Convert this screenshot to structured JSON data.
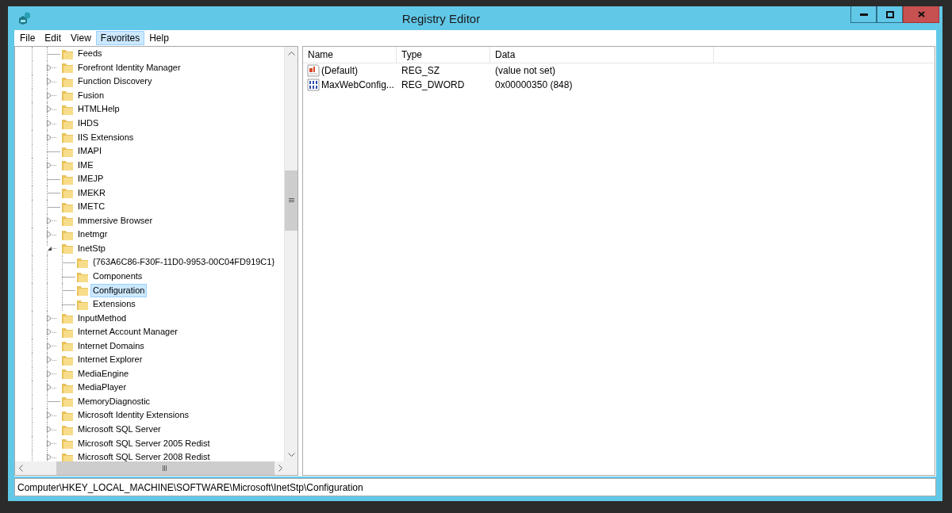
{
  "window": {
    "title": "Registry Editor"
  },
  "menu": [
    {
      "label": "File",
      "selected": false
    },
    {
      "label": "Edit",
      "selected": false
    },
    {
      "label": "View",
      "selected": false
    },
    {
      "label": "Favorites",
      "selected": true
    },
    {
      "label": "Help",
      "selected": false
    }
  ],
  "tree": {
    "items": [
      {
        "label": "Feeds",
        "kind": "leaf",
        "selected": false
      },
      {
        "label": "Forefront Identity Manager",
        "kind": "branch",
        "expanded": false,
        "selected": false
      },
      {
        "label": "Function Discovery",
        "kind": "branch",
        "expanded": false,
        "selected": false
      },
      {
        "label": "Fusion",
        "kind": "branch",
        "expanded": false,
        "selected": false
      },
      {
        "label": "HTMLHelp",
        "kind": "branch",
        "expanded": false,
        "selected": false
      },
      {
        "label": "IHDS",
        "kind": "branch",
        "expanded": false,
        "selected": false
      },
      {
        "label": "IIS Extensions",
        "kind": "branch",
        "expanded": false,
        "selected": false
      },
      {
        "label": "IMAPI",
        "kind": "leaf",
        "selected": false
      },
      {
        "label": "IME",
        "kind": "branch",
        "expanded": false,
        "selected": false
      },
      {
        "label": "IMEJP",
        "kind": "leaf",
        "selected": false
      },
      {
        "label": "IMEKR",
        "kind": "leaf",
        "selected": false
      },
      {
        "label": "IMETC",
        "kind": "leaf",
        "selected": false
      },
      {
        "label": "Immersive Browser",
        "kind": "branch",
        "expanded": false,
        "selected": false
      },
      {
        "label": "Inetmgr",
        "kind": "branch",
        "expanded": false,
        "selected": false
      },
      {
        "label": "InetStp",
        "kind": "branch",
        "expanded": true,
        "selected": false,
        "children": [
          {
            "label": "{763A6C86-F30F-11D0-9953-00C04FD919C1}",
            "kind": "leaf",
            "selected": false
          },
          {
            "label": "Components",
            "kind": "leaf",
            "selected": false
          },
          {
            "label": "Configuration",
            "kind": "leaf",
            "selected": true
          },
          {
            "label": "Extensions",
            "kind": "leaf",
            "selected": false
          }
        ]
      },
      {
        "label": "InputMethod",
        "kind": "branch",
        "expanded": false,
        "selected": false
      },
      {
        "label": "Internet Account Manager",
        "kind": "branch",
        "expanded": false,
        "selected": false
      },
      {
        "label": "Internet Domains",
        "kind": "branch",
        "expanded": false,
        "selected": false
      },
      {
        "label": "Internet Explorer",
        "kind": "branch",
        "expanded": false,
        "selected": false
      },
      {
        "label": "MediaEngine",
        "kind": "branch",
        "expanded": false,
        "selected": false
      },
      {
        "label": "MediaPlayer",
        "kind": "branch",
        "expanded": false,
        "selected": false
      },
      {
        "label": "MemoryDiagnostic",
        "kind": "leaf",
        "selected": false
      },
      {
        "label": "Microsoft Identity Extensions",
        "kind": "branch",
        "expanded": false,
        "selected": false
      },
      {
        "label": "Microsoft SQL Server",
        "kind": "branch",
        "expanded": false,
        "selected": false
      },
      {
        "label": "Microsoft SQL Server 2005 Redist",
        "kind": "branch",
        "expanded": false,
        "selected": false
      },
      {
        "label": "Microsoft SQL Server 2008 Redist",
        "kind": "branch",
        "expanded": false,
        "selected": false
      }
    ]
  },
  "values": {
    "columns": [
      "Name",
      "Type",
      "Data"
    ],
    "rows": [
      {
        "kind": "string",
        "name": "(Default)",
        "type": "REG_SZ",
        "data": "(value not set)"
      },
      {
        "kind": "dword",
        "name": "MaxWebConfig...",
        "type": "REG_DWORD",
        "data": "0x00000350 (848)"
      }
    ]
  },
  "status_bar": "Computer\\HKEY_LOCAL_MACHINE\\SOFTWARE\\Microsoft\\InetStp\\Configuration"
}
